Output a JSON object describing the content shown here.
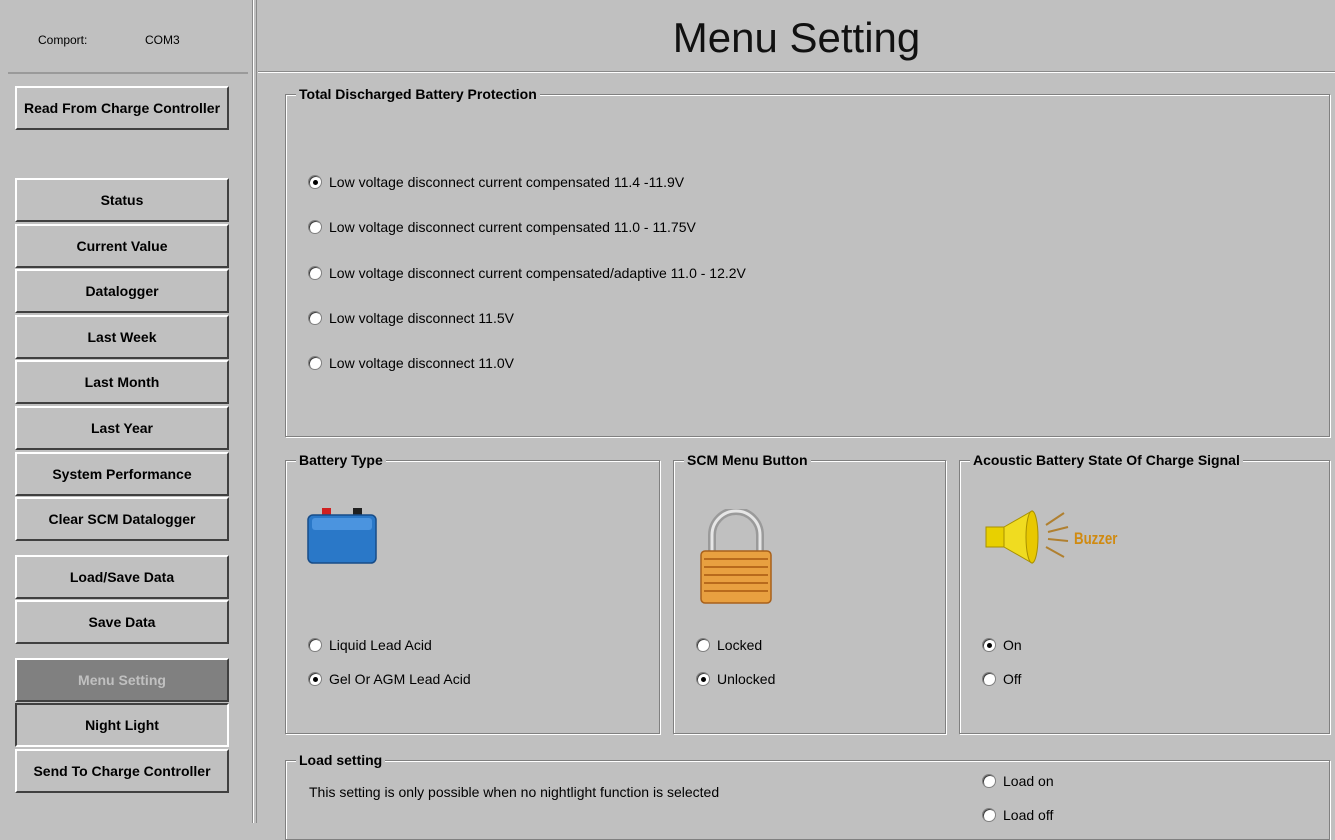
{
  "comport": {
    "label": "Comport:",
    "value": "COM3"
  },
  "sidebar": {
    "read_button": "Read From Charge Controller",
    "items": [
      {
        "label": "Status"
      },
      {
        "label": "Current Value"
      },
      {
        "label": "Datalogger"
      },
      {
        "label": "Last Week"
      },
      {
        "label": "Last Month"
      },
      {
        "label": "Last Year"
      },
      {
        "label": "System Performance"
      },
      {
        "label": "Clear SCM Datalogger"
      }
    ],
    "load_save": "Load/Save Data",
    "save": "Save Data",
    "menu_setting": "Menu Setting",
    "night_light": "Night Light",
    "send_button": "Send To Charge Controller"
  },
  "title": "Menu Setting",
  "discharge": {
    "title": "Total Discharged Battery Protection",
    "options": [
      {
        "label": "Low voltage disconnect current compensated 11.4 -11.9V",
        "selected": true
      },
      {
        "label": "Low voltage disconnect current compensated 11.0 - 11.75V",
        "selected": false
      },
      {
        "label": "Low voltage disconnect current compensated/adaptive 11.0 - 12.2V",
        "selected": false
      },
      {
        "label": "Low voltage disconnect 11.5V",
        "selected": false
      },
      {
        "label": "Low voltage disconnect 11.0V",
        "selected": false
      }
    ]
  },
  "battery_type": {
    "title": "Battery Type",
    "options": [
      {
        "label": "Liquid Lead Acid",
        "selected": false
      },
      {
        "label": "Gel Or AGM Lead Acid",
        "selected": true
      }
    ]
  },
  "scm_menu": {
    "title": "SCM Menu Button",
    "options": [
      {
        "label": "Locked",
        "selected": false
      },
      {
        "label": "Unlocked",
        "selected": true
      }
    ]
  },
  "acoustic": {
    "title": "Acoustic Battery State Of Charge Signal",
    "buzzer_label": "Buzzer",
    "options": [
      {
        "label": "On",
        "selected": true
      },
      {
        "label": "Off",
        "selected": false
      }
    ]
  },
  "load": {
    "title": "Load setting",
    "note": "This setting is only possible when no nightlight function is selected",
    "options": [
      {
        "label": "Load on",
        "selected": false
      },
      {
        "label": "Load off",
        "selected": false
      }
    ]
  },
  "colors": {
    "background": "#c0c0c0",
    "disabled_button": "#808080",
    "battery": "#2a78c8",
    "lock": "#e8a040",
    "buzzer": "#e8d000"
  }
}
